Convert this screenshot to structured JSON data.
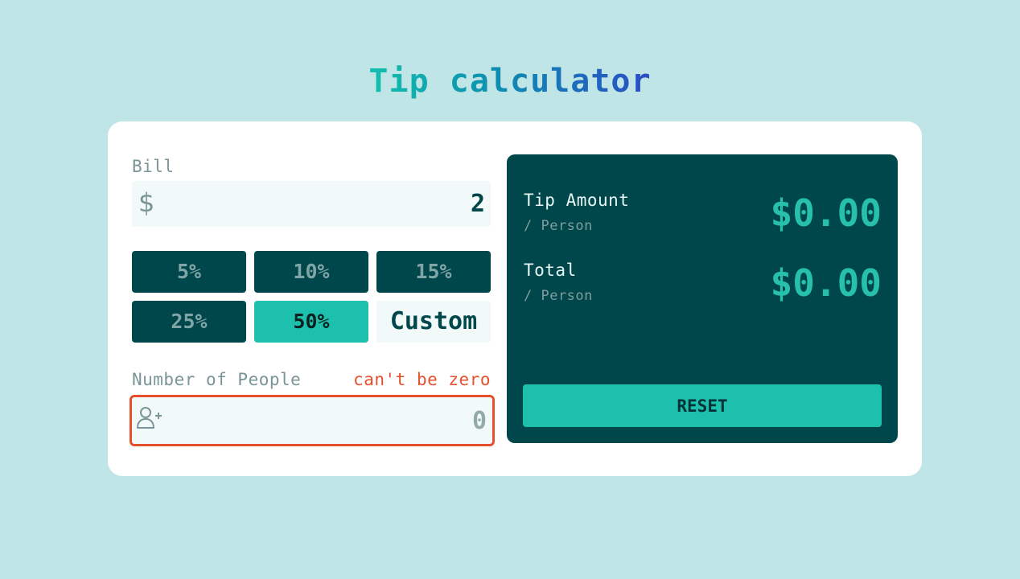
{
  "header": {
    "title": "Tip calculator"
  },
  "bill": {
    "label": "Bill",
    "currency_icon": "dollar-icon",
    "currency_symbol": "$",
    "value": "2"
  },
  "tip_options": [
    {
      "label": "5%",
      "selected": false
    },
    {
      "label": "10%",
      "selected": false
    },
    {
      "label": "15%",
      "selected": false
    },
    {
      "label": "25%",
      "selected": false
    },
    {
      "label": "50%",
      "selected": true
    },
    {
      "label": "Custom",
      "selected": false
    }
  ],
  "people": {
    "label": "Number of People",
    "error": "can't be zero",
    "icon": "person-add-icon",
    "value": "0"
  },
  "results": {
    "tip_title": "Tip Amount",
    "tip_sub": "/ Person",
    "tip_value": "$0.00",
    "total_title": "Total",
    "total_sub": "/ Person",
    "total_value": "$0.00"
  },
  "reset_label": "RESET",
  "colors": {
    "background": "#c0e5e6",
    "panel": "#00474b",
    "accent": "#1cc0ac",
    "error": "#e5502d"
  }
}
